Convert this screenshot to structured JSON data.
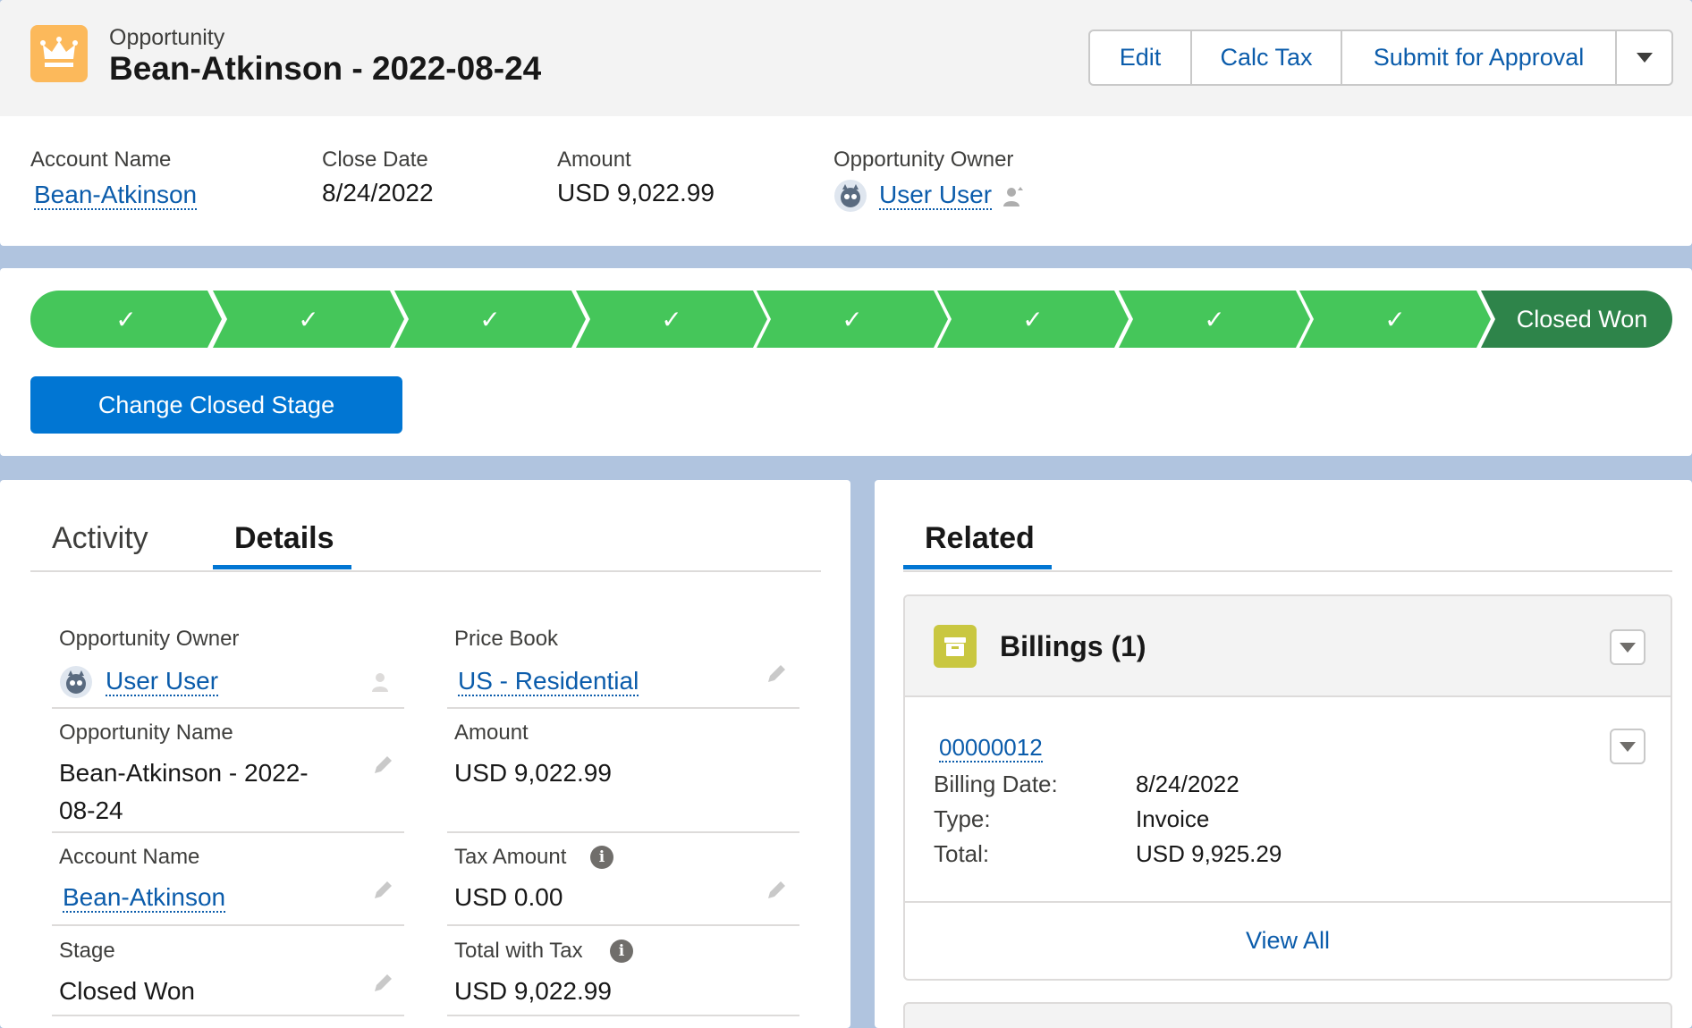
{
  "header": {
    "object_type": "Opportunity",
    "title": "Bean-Atkinson - 2022-08-24",
    "icon": "crown-icon",
    "icon_color": "#fcb95b",
    "actions": [
      "Edit",
      "Calc Tax",
      "Submit for Approval"
    ]
  },
  "highlights": {
    "account_name_label": "Account Name",
    "account_name": "Bean-Atkinson",
    "close_date_label": "Close Date",
    "close_date": "8/24/2022",
    "amount_label": "Amount",
    "amount": "USD 9,022.99",
    "owner_label": "Opportunity Owner",
    "owner": "User User"
  },
  "path": {
    "completed_steps": 8,
    "current_stage": "Closed Won",
    "change_button": "Change Closed Stage",
    "complete_color": "#45c65a",
    "current_color": "#2e844a"
  },
  "tabs": {
    "activity": "Activity",
    "details": "Details",
    "related": "Related"
  },
  "details": {
    "owner_label": "Opportunity Owner",
    "owner": "User User",
    "price_book_label": "Price Book",
    "price_book": "US - Residential",
    "opp_name_label": "Opportunity Name",
    "opp_name_line1": "Bean-Atkinson - 2022-",
    "opp_name_line2": "08-24",
    "amount_label": "Amount",
    "amount": "USD 9,022.99",
    "account_label": "Account Name",
    "account": "Bean-Atkinson",
    "tax_label": "Tax Amount",
    "tax": "USD 0.00",
    "stage_label": "Stage",
    "stage": "Closed Won",
    "total_tax_label": "Total with Tax",
    "total_tax": "USD 9,022.99"
  },
  "related": {
    "billings_title": "Billings (1)",
    "billings_icon_color": "#c9c740",
    "record": {
      "number": "00000012",
      "billing_date_label": "Billing Date:",
      "billing_date": "8/24/2022",
      "type_label": "Type:",
      "type": "Invoice",
      "total_label": "Total:",
      "total": "USD 9,925.29"
    },
    "view_all": "View All"
  }
}
